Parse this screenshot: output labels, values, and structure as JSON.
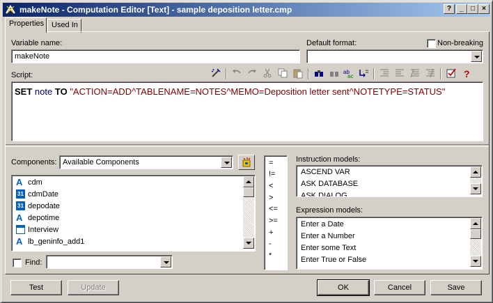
{
  "window": {
    "title": "makeNote - Computation Editor [Text] - sample deposition letter.cmp",
    "help_button": "?",
    "minimize_button": "_",
    "maximize_button": "□",
    "close_button": "×"
  },
  "tabs": [
    {
      "label": "Properties",
      "active": true
    },
    {
      "label": "Used In",
      "active": false
    }
  ],
  "properties": {
    "variable_name_label": "Variable name:",
    "variable_name_value": "makeNote",
    "default_format_label": "Default format:",
    "default_format_value": "",
    "non_breaking_label": "Non-breaking",
    "non_breaking_checked": false,
    "script_label": "Script:"
  },
  "script": {
    "kw_set": "SET",
    "var_name": "note",
    "kw_to": "TO",
    "string_value": "\"ACTION=ADD^TABLENAME=NOTES^MEMO=Deposition letter sent^NOTETYPE=STATUS\""
  },
  "components": {
    "label": "Components:",
    "selected": "Available Components",
    "items": [
      {
        "label": "cdm",
        "icon": "text-var-icon"
      },
      {
        "label": "cdmDate",
        "icon": "date-var-icon"
      },
      {
        "label": "depodate",
        "icon": "date-var-icon"
      },
      {
        "label": "depotime",
        "icon": "text-var-icon"
      },
      {
        "label": "Interview",
        "icon": "dialog-icon"
      },
      {
        "label": "lb_geninfo_add1",
        "icon": "text-var-icon"
      }
    ],
    "find_label": "Find:",
    "find_value": ""
  },
  "operators": [
    "=",
    "!=",
    "<",
    ">",
    "<=",
    ">=",
    "+",
    "-",
    "*"
  ],
  "instruction_models": {
    "label": "Instruction models:",
    "items": [
      "ASCEND VAR",
      "ASK DATABASE",
      "ASK DIALOG"
    ]
  },
  "expression_models": {
    "label": "Expression models:",
    "items": [
      "Enter a Date",
      "Enter a Number",
      "Enter some Text",
      "Enter True or False"
    ]
  },
  "buttons": {
    "test": "Test",
    "update": "Update",
    "ok": "OK",
    "cancel": "Cancel",
    "save": "Save"
  },
  "colors": {
    "title_start": "#0a246a",
    "title_end": "#a6caf0",
    "keyword": "#000000",
    "variable": "#000080",
    "string": "#800000"
  }
}
